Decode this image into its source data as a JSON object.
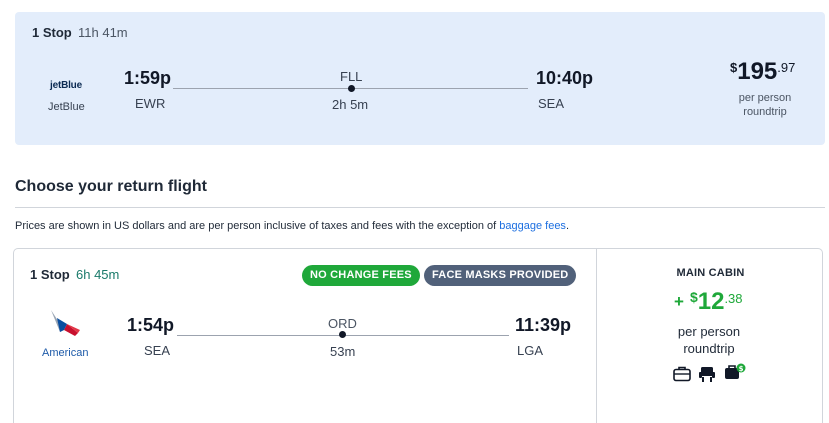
{
  "outbound": {
    "stops": "1 Stop",
    "duration": "11h 41m",
    "airline_logo_text": "jetBlue",
    "airline_name": "JetBlue",
    "depart_time": "1:59p",
    "depart_airport": "EWR",
    "via_airport": "FLL",
    "layover": "2h 5m",
    "arrive_time": "10:40p",
    "arrive_airport": "SEA",
    "price_currency": "$",
    "price_whole": "195",
    "price_cents": ".97",
    "price_basis_line1": "per person",
    "price_basis_line2": "roundtrip"
  },
  "section": {
    "title": "Choose your return flight",
    "note_prefix": "Prices are shown in US dollars and are per person inclusive of taxes and fees with the exception of ",
    "note_link": "baggage fees",
    "note_suffix": "."
  },
  "return_flight": {
    "stops": "1 Stop",
    "duration": "6h 45m",
    "badges": [
      "NO CHANGE FEES",
      "FACE MASKS PROVIDED"
    ],
    "airline_name": "American",
    "depart_time": "1:54p",
    "depart_airport": "SEA",
    "via_airport": "ORD",
    "layover": "53m",
    "arrive_time": "11:39p",
    "arrive_airport": "LGA",
    "cabin": "MAIN CABIN",
    "price_prefix": "+",
    "price_currency": "$",
    "price_whole": "12",
    "price_cents": ".38",
    "price_basis_line1": "per person",
    "price_basis_line2": "roundtrip",
    "amenity_icons": [
      "checked-bag-icon",
      "seat-icon",
      "carry-on-fee-icon"
    ]
  },
  "colors": {
    "selected_bg": "#e3edfb",
    "accent_green": "#1fa83a",
    "badge_slate": "#51617a",
    "link_blue": "#1d6fe0",
    "american_blue": "#1d5aa8"
  }
}
